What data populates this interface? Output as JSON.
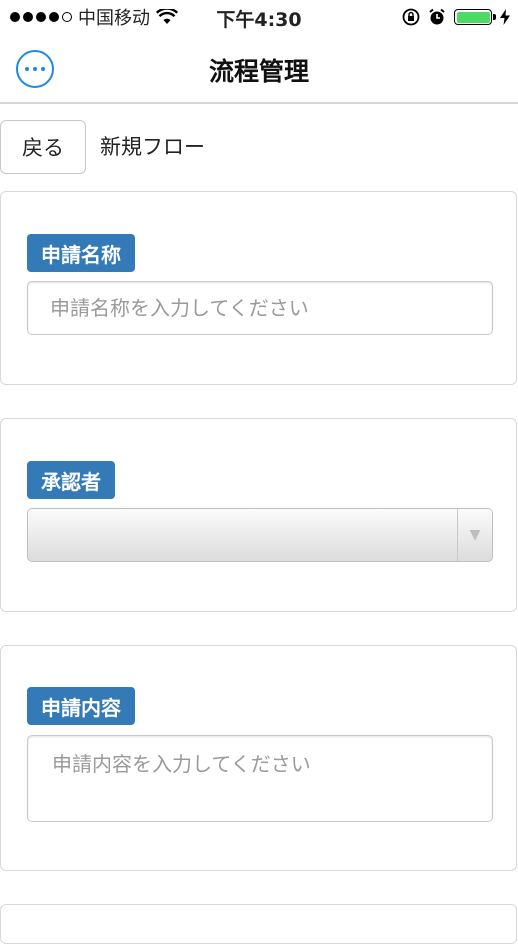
{
  "status_bar": {
    "carrier": "中国移动",
    "time": "下午4:30",
    "signal_icon": "signal-dots-icon",
    "wifi_icon": "wifi-icon",
    "lock_icon": "rotation-lock-icon",
    "alarm_icon": "alarm-icon",
    "battery_icon": "battery-icon",
    "charging_icon": "charging-bolt-icon",
    "battery_color": "#4cd964"
  },
  "navbar": {
    "title": "流程管理",
    "more_icon": "more-icon"
  },
  "header": {
    "back_label": "戻る",
    "heading": "新規フロー"
  },
  "form": {
    "name_card": {
      "label": "申請名称",
      "placeholder": "申請名称を入力してください",
      "value": ""
    },
    "approver_card": {
      "label": "承認者",
      "selected": "",
      "dropdown_icon": "triangle-down-icon"
    },
    "content_card": {
      "label": "申請内容",
      "placeholder": "申請内容を入力してください",
      "value": ""
    }
  },
  "colors": {
    "label_bg": "#337ab7",
    "accent": "#1e88e5"
  }
}
